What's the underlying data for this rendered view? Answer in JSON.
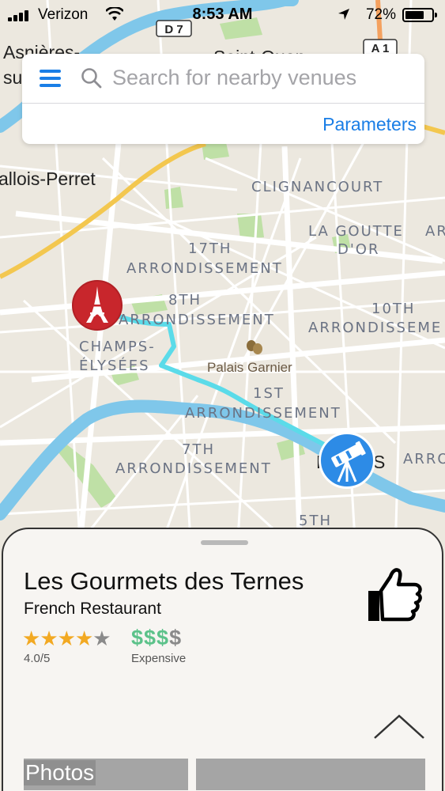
{
  "status_bar": {
    "carrier": "Verizon",
    "time": "8:53 AM",
    "battery_percent": "72%",
    "battery_level": 0.72
  },
  "search": {
    "placeholder": "Search for nearby venues",
    "parameters_label": "Parameters",
    "menu_icon": "hamburger-menu-icon",
    "search_icon": "magnifier-icon"
  },
  "map": {
    "labels": {
      "asnieres_1": "Asnières-",
      "asnieres_2": "sur",
      "saint_ouen": "Saint-Ouen",
      "levallois": "allois-Perret",
      "clignancourt": "CLIGNANCOURT",
      "goutte_1": "LA GOUTTE",
      "goutte_2": "D'OR",
      "arr17_1": "17TH",
      "arr17_2": "ARRONDISSEMENT",
      "arr8_1": "8TH",
      "arr8_2": "ARRONDISSEMENT",
      "arr10_1": "10TH",
      "arr10_2": "ARRONDISSEME",
      "champs_1": "CHAMPS-",
      "champs_2": "ÉLYSÉES",
      "palais": "Palais Garnier",
      "arr1_1": "1ST",
      "arr1_2": "ARRONDISSEMENT",
      "arr7_1": "7TH",
      "arr7_2": "ARRONDISSEMENT",
      "arr_right": "ARRO",
      "arr_right_top": "AR",
      "paris_1": "P",
      "paris_2": "S",
      "arr5": "5TH",
      "road_d7": "D 7",
      "road_a1": "A 1"
    },
    "route_color": "#5bdbe9",
    "start_pin_icon": "eiffel-tower-icon",
    "end_pin_icon": "telescope-icon"
  },
  "venue": {
    "name": "Les Gourmets des Ternes",
    "category": "French Restaurant",
    "rating": 4.0,
    "rating_max": 5,
    "rating_text": "4.0/5",
    "price_symbols_active": "$$$",
    "price_symbols_inactive": "$",
    "price_text": "Expensive",
    "like_icon": "thumbs-up-icon",
    "expand_icon": "chevron-up-icon",
    "tabs": [
      "Photos",
      ""
    ]
  }
}
